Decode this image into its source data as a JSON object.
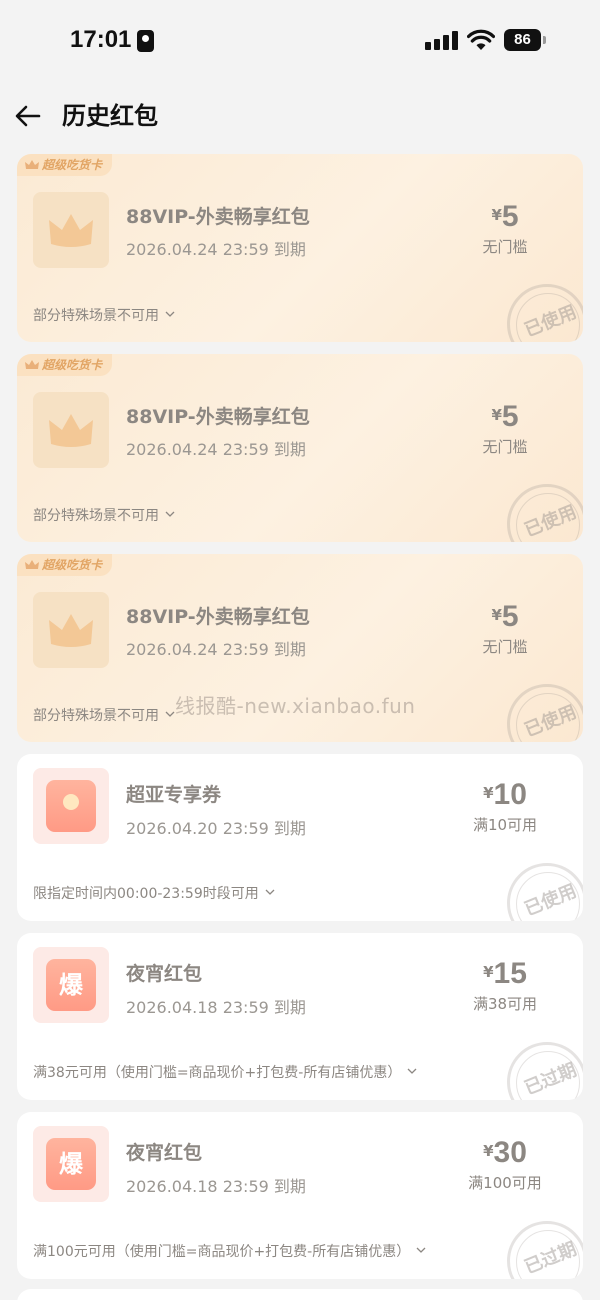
{
  "status": {
    "time": "17:01",
    "battery": "86"
  },
  "header": {
    "title": "历史红包"
  },
  "vip_tag": "超级吃货卡",
  "coupons": [
    {
      "kind": "vip",
      "title": "88VIP-外卖畅享红包",
      "expiry": "2026.04.24 23:59 到期",
      "currency": "¥",
      "amount": "5",
      "condition": "无门槛",
      "rule": "部分特殊场景不可用",
      "stamp": "已使用"
    },
    {
      "kind": "vip",
      "title": "88VIP-外卖畅享红包",
      "expiry": "2026.04.24 23:59 到期",
      "currency": "¥",
      "amount": "5",
      "condition": "无门槛",
      "rule": "部分特殊场景不可用",
      "stamp": "已使用"
    },
    {
      "kind": "vip",
      "title": "88VIP-外卖畅享红包",
      "expiry": "2026.04.24 23:59 到期",
      "currency": "¥",
      "amount": "5",
      "condition": "无门槛",
      "rule": "部分特殊场景不可用",
      "stamp": "已使用"
    },
    {
      "kind": "normal",
      "icon": "red-envelope-icon",
      "title": "超亚专享券",
      "expiry": "2026.04.20 23:59 到期",
      "currency": "¥",
      "amount": "10",
      "condition": "满10可用",
      "rule": "限指定时间内00:00-23:59时段可用",
      "stamp": "已使用"
    },
    {
      "kind": "normal",
      "icon": "boom-icon",
      "icon_text": "爆",
      "title": "夜宵红包",
      "expiry": "2026.04.18 23:59 到期",
      "currency": "¥",
      "amount": "15",
      "condition": "满38可用",
      "rule": "满38元可用（使用门槛=商品现价+打包费-所有店铺优惠）",
      "stamp": "已过期"
    },
    {
      "kind": "normal",
      "icon": "boom-icon",
      "icon_text": "爆",
      "title": "夜宵红包",
      "expiry": "2026.04.18 23:59 到期",
      "currency": "¥",
      "amount": "30",
      "condition": "满100可用",
      "rule": "满100元可用（使用门槛=商品现价+打包费-所有店铺优惠）",
      "stamp": "已过期"
    }
  ],
  "watermark": "线报酷-new.xianbao.fun",
  "colors": {
    "vip_bg": "#fdf0e0",
    "card_bg": "#ffffff",
    "muted_text": "#8c8782",
    "page_bg": "#f3f3f3"
  }
}
